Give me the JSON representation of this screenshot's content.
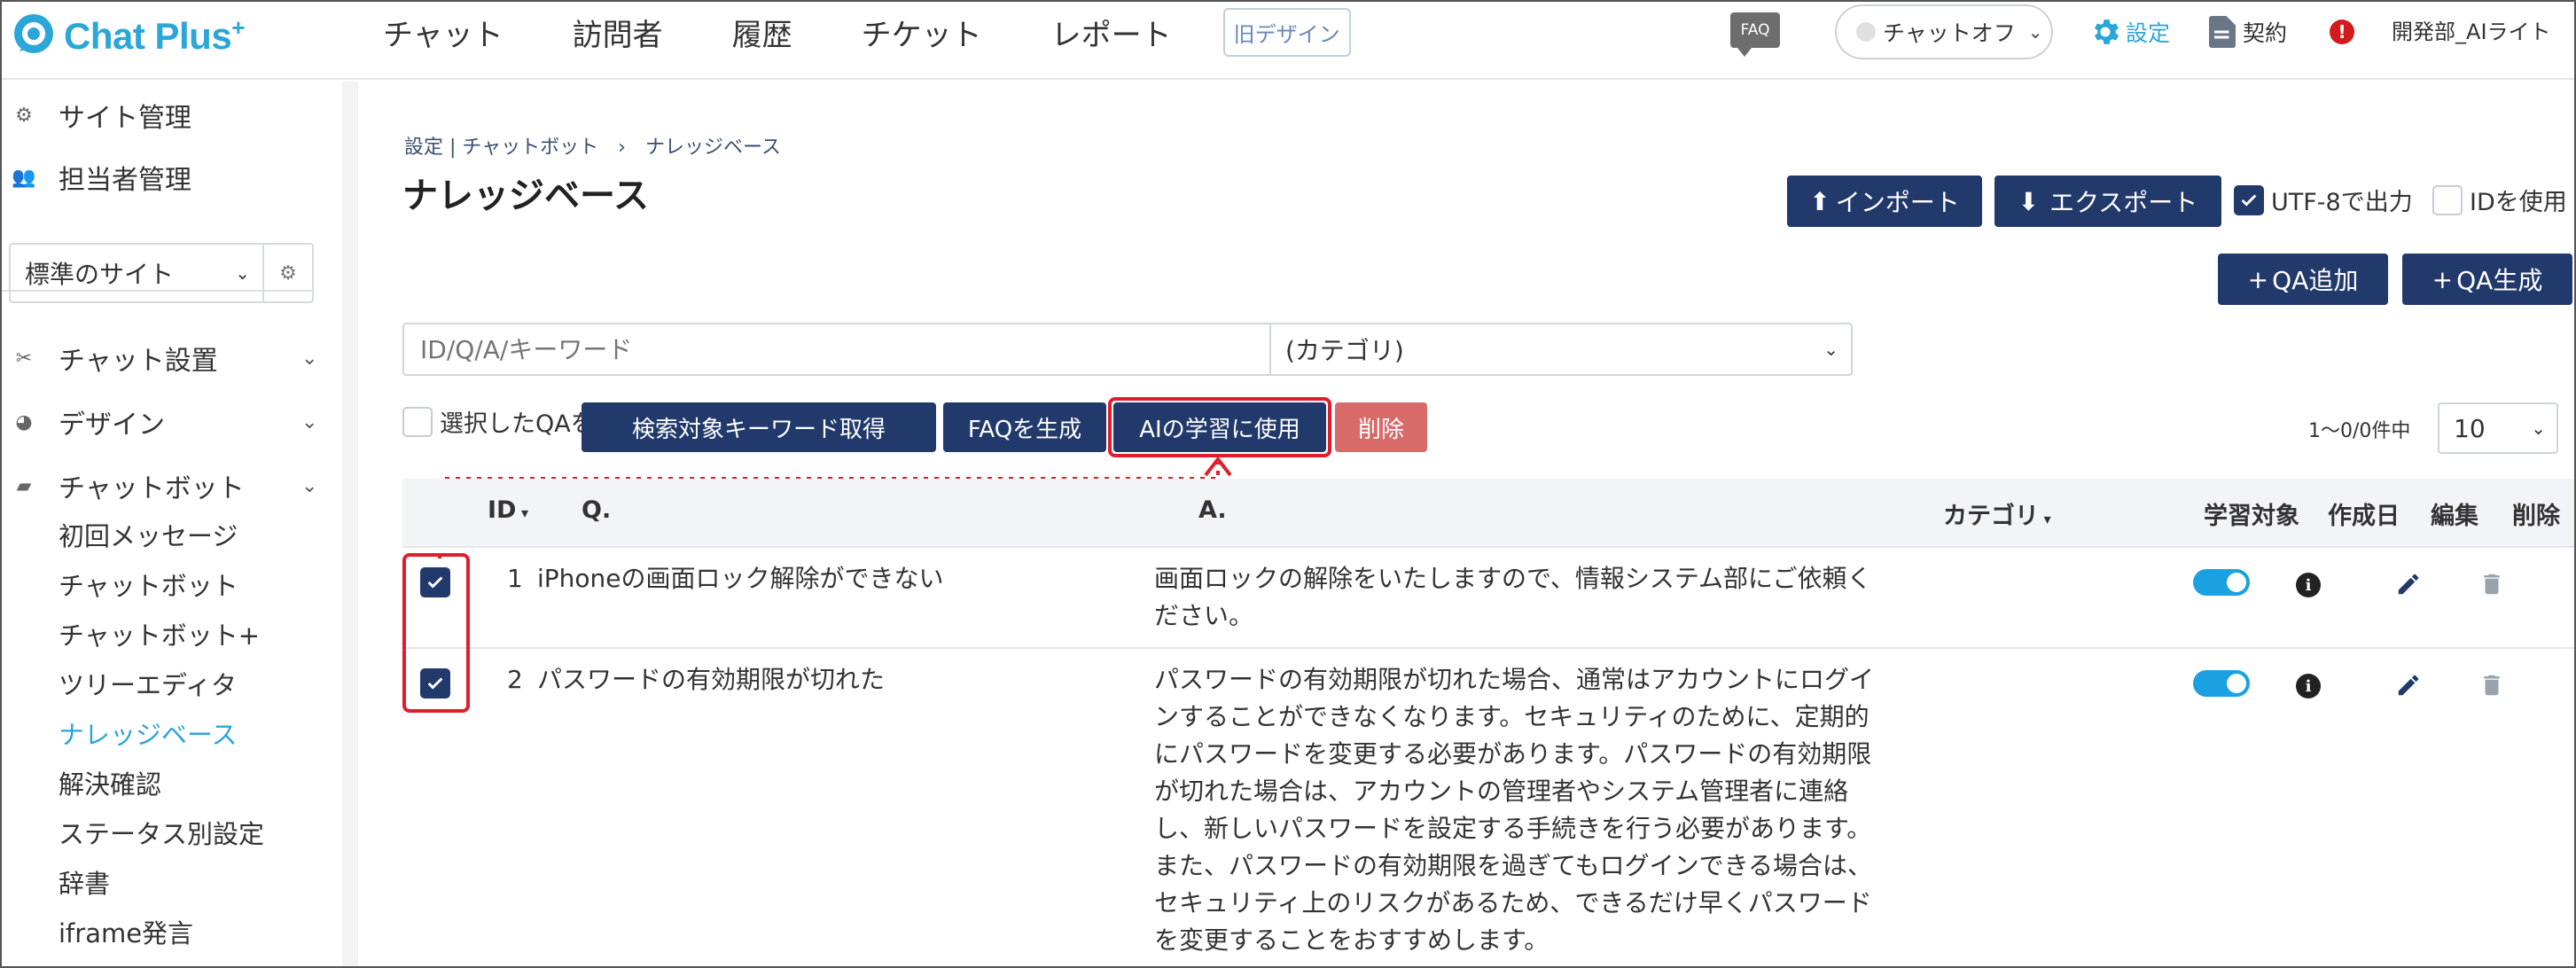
{
  "header": {
    "brand": "Chat Plus",
    "brand_sup": "+",
    "nav": [
      "チャット",
      "訪問者",
      "履歴",
      "チケット",
      "レポート"
    ],
    "old_design": "旧デザイン",
    "faq_badge": "FAQ",
    "chat_status": "チャットオフ",
    "settings": "設定",
    "contract": "契約",
    "alert": "!",
    "user": "開発部_AIライト"
  },
  "sidebar": {
    "site_management": "サイト管理",
    "staff_management": "担当者管理",
    "site_select": "標準のサイト",
    "chat_settings": "チャット設置",
    "design": "デザイン",
    "chatbot": "チャットボット",
    "chatbot_sub": [
      "初回メッセージ",
      "チャットボット",
      "チャットボット+",
      "ツリーエディタ",
      "ナレッジベース",
      "解決確認",
      "ステータス別設定",
      "辞書",
      "iframe発言"
    ],
    "active_sub": "ナレッジベース"
  },
  "main": {
    "breadcrumb": "設定 | チャットボット　›　ナレッジベース",
    "title": "ナレッジベース",
    "import": "インポート",
    "export": "エクスポート",
    "utf8": "UTF-8で出力",
    "use_id": "IDを使用",
    "add_qa": "QA追加",
    "gen_qa": "QA生成",
    "search_placeholder": "ID/Q/A/キーワード",
    "category_select": "(カテゴリ)",
    "selected_label": "選択したQAを:",
    "btn_keyword": "検索対象キーワード取得",
    "btn_faq": "FAQを生成",
    "btn_ai": "AIの学習に使用",
    "btn_delete": "削除",
    "paging": "1～0/0件中",
    "per_page": "10",
    "columns": {
      "id": "ID",
      "q": "Q.",
      "a": "A.",
      "category": "カテゴリ",
      "learn": "学習対象",
      "created": "作成日",
      "edit": "編集",
      "delete": "削除"
    },
    "rows": [
      {
        "id": "1",
        "q": "iPhoneの画面ロック解除ができない",
        "a_lines": [
          "画面ロックの解除をいたしますので、情報システム部にご依頼く",
          "ださい。"
        ]
      },
      {
        "id": "2",
        "q": "パスワードの有効期限が切れた",
        "a_lines": [
          "パスワードの有効期限が切れた場合、通常はアカウントにログイ",
          "ンすることができなくなります。セキュリティのために、定期的",
          "にパスワードを変更する必要があります。パスワードの有効期限",
          "が切れた場合は、アカウントの管理者やシステム管理者に連絡",
          "し、新しいパスワードを設定する手続きを行う必要があります。",
          "また、パスワードの有効期限を過ぎてもログインできる場合は、",
          "セキュリティ上のリスクがあるため、できるだけ早くパスワード",
          "を変更することをおすすめします。"
        ]
      }
    ]
  }
}
